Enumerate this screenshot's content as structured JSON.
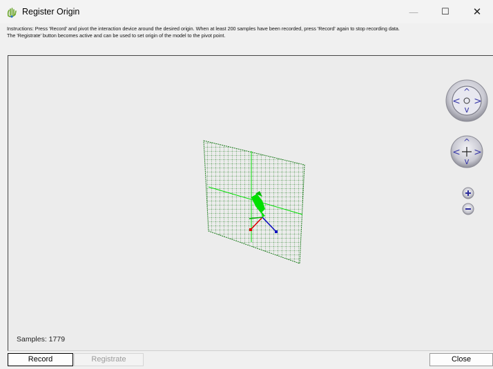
{
  "window": {
    "title": "Register Origin",
    "icon": "hand-gesture-icon",
    "minimize_glyph": "—",
    "maximize_glyph": "☐",
    "close_glyph": "✕"
  },
  "instructions": {
    "line1": "Instructions: Press 'Record' and pivot the interaction device around the desired origin. When at least 200 samples have been recorded, press 'Record' again to stop recording data.",
    "line2": "The 'Registrate' button becomes active and can be used to set origin of the model to the pivot point."
  },
  "viewport": {
    "samples_label": "Samples: 1779",
    "nav_controls": [
      "rotate-wheel-icon",
      "pan-wheel-icon",
      "zoom-in-icon",
      "zoom-out-icon"
    ],
    "colors": {
      "grid": "#1b7a1b",
      "pointer": "#00e000",
      "axis_x": "#e00000",
      "axis_y": "#00b400",
      "axis_z": "#1010c0"
    }
  },
  "buttons": {
    "record": "Record",
    "registrate": "Registrate",
    "close": "Close"
  }
}
